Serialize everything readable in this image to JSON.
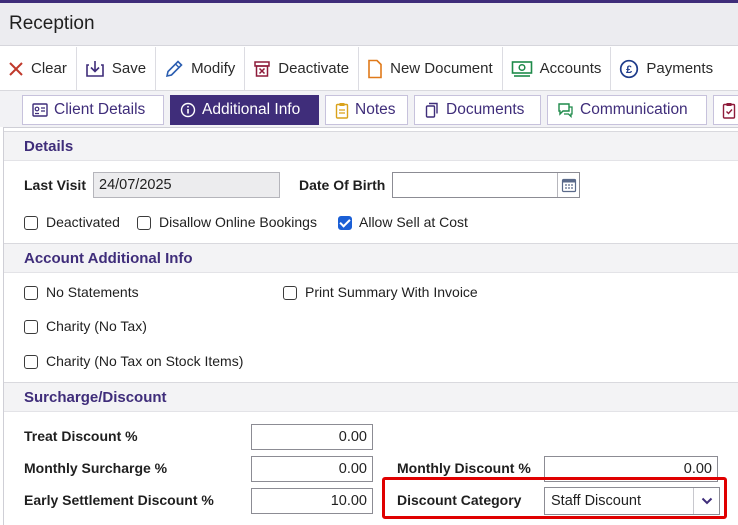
{
  "window": {
    "title": "Reception"
  },
  "toolbar": {
    "items": [
      {
        "label": "Clear",
        "icon": "close-icon"
      },
      {
        "label": "Save",
        "icon": "save-icon"
      },
      {
        "label": "Modify",
        "icon": "edit-icon"
      },
      {
        "label": "Deactivate",
        "icon": "deactivate-icon"
      },
      {
        "label": "New Document",
        "icon": "document-icon"
      },
      {
        "label": "Accounts",
        "icon": "accounts-icon"
      },
      {
        "label": "Payments",
        "icon": "payments-icon"
      }
    ]
  },
  "tabs": [
    {
      "label": "Client Details",
      "active": false
    },
    {
      "label": "Additional Info",
      "active": true
    },
    {
      "label": "Notes",
      "active": false
    },
    {
      "label": "Documents",
      "active": false
    },
    {
      "label": "Communication",
      "active": false
    }
  ],
  "details": {
    "heading": "Details",
    "last_visit_label": "Last Visit",
    "last_visit_value": "24/07/2025",
    "dob_label": "Date Of Birth",
    "dob_value": "",
    "deactivated_label": "Deactivated",
    "deactivated_checked": false,
    "disallow_label": "Disallow Online Bookings",
    "disallow_checked": false,
    "sell_cost_label": "Allow Sell at Cost",
    "sell_cost_checked": true
  },
  "account_info": {
    "heading": "Account Additional Info",
    "no_statements_label": "No Statements",
    "print_summary_label": "Print Summary With Invoice",
    "charity_label": "Charity (No Tax)",
    "charity_stock_label": "Charity (No Tax on Stock Items)"
  },
  "surcharge": {
    "heading": "Surcharge/Discount",
    "treat_label": "Treat Discount %",
    "treat_value": "0.00",
    "monthly_surcharge_label": "Monthly Surcharge %",
    "monthly_surcharge_value": "0.00",
    "monthly_discount_label": "Monthly Discount %",
    "monthly_discount_value": "0.00",
    "early_label": "Early Settlement Discount %",
    "early_value": "10.00",
    "category_label": "Discount Category",
    "category_value": "Staff Discount"
  },
  "colors": {
    "brand": "#3f2d7a",
    "highlight": "#e00000",
    "checkbox": "#1a5fd6"
  }
}
